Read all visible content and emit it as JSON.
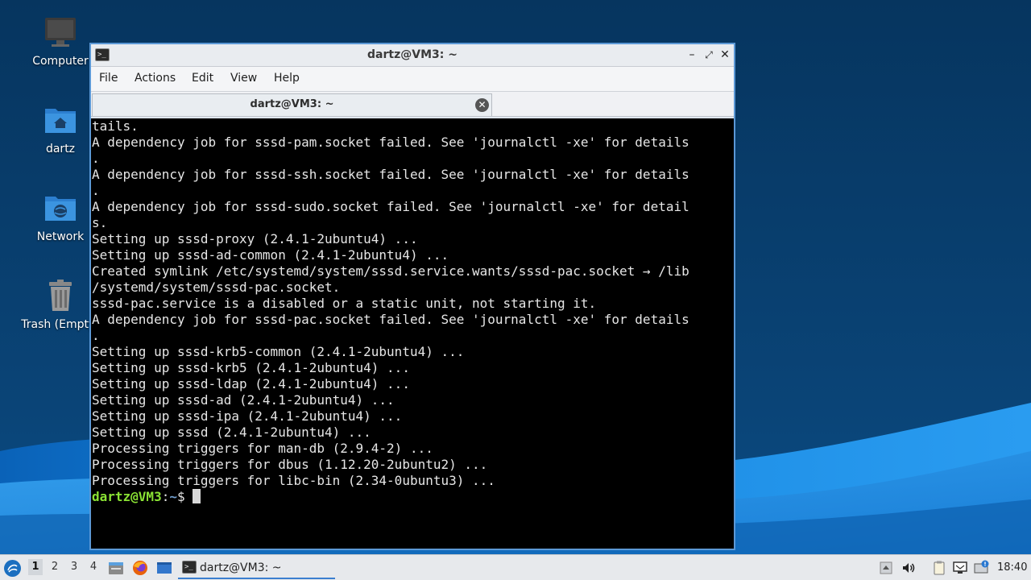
{
  "desktop": {
    "icons": [
      {
        "label": "Computer"
      },
      {
        "label": "dartz"
      },
      {
        "label": "Network"
      },
      {
        "label": "Trash (Empty)"
      }
    ]
  },
  "window": {
    "title": "dartz@VM3: ~",
    "menu": [
      "File",
      "Actions",
      "Edit",
      "View",
      "Help"
    ],
    "tab_label": "dartz@VM3: ~",
    "terminal": {
      "lines": [
        "tails.",
        "A dependency job for sssd-pam.socket failed. See 'journalctl -xe' for details",
        ".",
        "A dependency job for sssd-ssh.socket failed. See 'journalctl -xe' for details",
        ".",
        "A dependency job for sssd-sudo.socket failed. See 'journalctl -xe' for detail",
        "s.",
        "Setting up sssd-proxy (2.4.1-2ubuntu4) ...",
        "Setting up sssd-ad-common (2.4.1-2ubuntu4) ...",
        "Created symlink /etc/systemd/system/sssd.service.wants/sssd-pac.socket → /lib",
        "/systemd/system/sssd-pac.socket.",
        "sssd-pac.service is a disabled or a static unit, not starting it.",
        "A dependency job for sssd-pac.socket failed. See 'journalctl -xe' for details",
        ".",
        "Setting up sssd-krb5-common (2.4.1-2ubuntu4) ...",
        "Setting up sssd-krb5 (2.4.1-2ubuntu4) ...",
        "Setting up sssd-ldap (2.4.1-2ubuntu4) ...",
        "Setting up sssd-ad (2.4.1-2ubuntu4) ...",
        "Setting up sssd-ipa (2.4.1-2ubuntu4) ...",
        "Setting up sssd (2.4.1-2ubuntu4) ...",
        "Processing triggers for man-db (2.9.4-2) ...",
        "Processing triggers for dbus (1.12.20-2ubuntu2) ...",
        "Processing triggers for libc-bin (2.34-0ubuntu3) ..."
      ],
      "prompt": {
        "user_host": "dartz@VM3",
        "colon": ":",
        "path": "~",
        "symbol": "$ "
      }
    }
  },
  "taskbar": {
    "workspaces": [
      "1",
      "2",
      "3",
      "4"
    ],
    "active_workspace": "1",
    "task_label": "dartz@VM3: ~",
    "clock": "18:40",
    "quick_launch_icons": [
      "file-manager-icon",
      "firefox-icon",
      "show-desktop-icon"
    ],
    "tray_icons": [
      "tray-arrow-icon",
      "volume-icon",
      "clipboard-icon",
      "network-icon",
      "update-notifier-icon"
    ]
  },
  "colors": {
    "wallpaper_top": "#053a6b",
    "wallpaper_accent": "#1e8ee6",
    "window_border": "#5b98d6",
    "prompt_user": "#8ae234",
    "prompt_path": "#729fcf",
    "terminal_bg": "#000000"
  }
}
